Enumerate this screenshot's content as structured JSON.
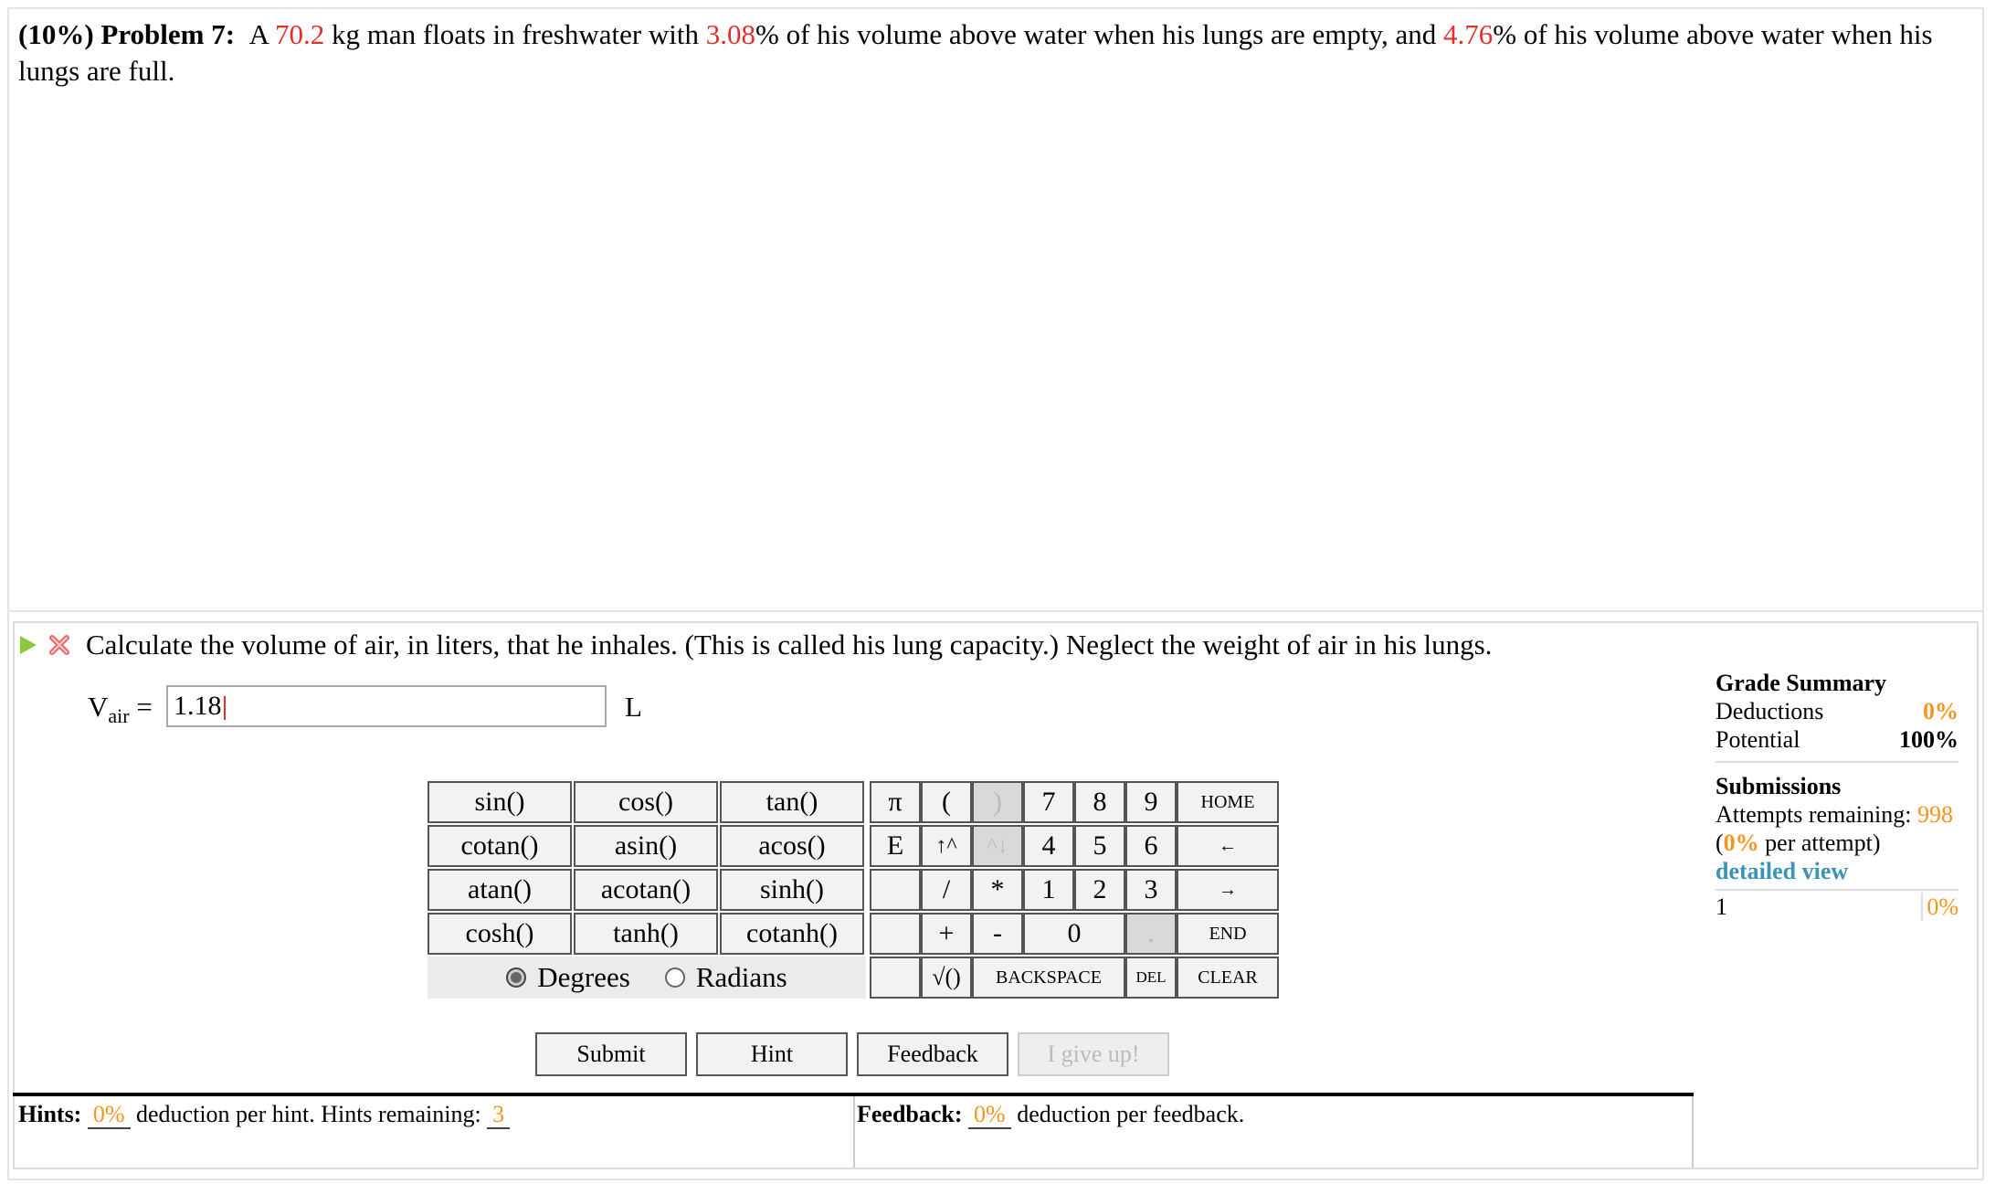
{
  "problem": {
    "weight_pct": "(10%)",
    "title": "Problem 7:",
    "t1": "A ",
    "mass": "70.2",
    "t2": " kg man floats in freshwater with ",
    "empty_pct": "3.08",
    "t3": "% of his volume above water when his lungs are empty, and ",
    "full_pct": "4.76",
    "t4": "% of his volume above water when his lungs are full."
  },
  "question": {
    "text": "Calculate the volume of air, in liters, that he inhales. (This is called his lung capacity.) Neglect the weight of air in his lungs.",
    "var_main": "V",
    "var_sub": "air",
    "equals": "=",
    "answer_value": "1.18",
    "unit": "L"
  },
  "function_keys": [
    "sin()",
    "cos()",
    "tan()",
    "cotan()",
    "asin()",
    "acos()",
    "atan()",
    "acotan()",
    "sinh()",
    "cosh()",
    "tanh()",
    "cotanh()"
  ],
  "angle_mode": {
    "degrees": "Degrees",
    "radians": "Radians",
    "selected": "Degrees"
  },
  "keypad": {
    "pi": "π",
    "lparen": "(",
    "rparen": ")",
    "e": "E",
    "up": "↑^",
    "down": "^↓",
    "div": "/",
    "mul": "*",
    "plus": "+",
    "minus": "-",
    "sqrt": "√()",
    "backspace": "BACKSPACE",
    "del": "DEL",
    "clear": "CLEAR",
    "home": "HOME",
    "left": "←",
    "right": "→",
    "end": "END",
    "d7": "7",
    "d8": "8",
    "d9": "9",
    "d4": "4",
    "d5": "5",
    "d6": "6",
    "d1": "1",
    "d2": "2",
    "d3": "3",
    "d0": "0",
    "dot": "."
  },
  "actions": {
    "submit": "Submit",
    "hint": "Hint",
    "feedback": "Feedback",
    "give_up": "I give up!"
  },
  "hints": {
    "label": "Hints:",
    "pct": "0%",
    "t1": "deduction per hint. Hints remaining:",
    "remaining": "3"
  },
  "feedback": {
    "label": "Feedback:",
    "pct": "0%",
    "t1": "deduction per feedback."
  },
  "grade_summary": {
    "title": "Grade Summary",
    "deductions_label": "Deductions",
    "deductions": "0%",
    "potential_label": "Potential",
    "potential": "100%",
    "submissions_title": "Submissions",
    "attempts_label": "Attempts remaining:",
    "attempts": "998",
    "per_attempt_pre": "(",
    "per_attempt_pct": "0%",
    "per_attempt_post": " per attempt)",
    "detailed_view": "detailed view",
    "sub_num": "1",
    "sub_pct": "0%"
  },
  "colors": {
    "given_value": "#e0302b",
    "accent": "#f7941d",
    "link": "#3a93b8",
    "play": "#8dc63f"
  }
}
